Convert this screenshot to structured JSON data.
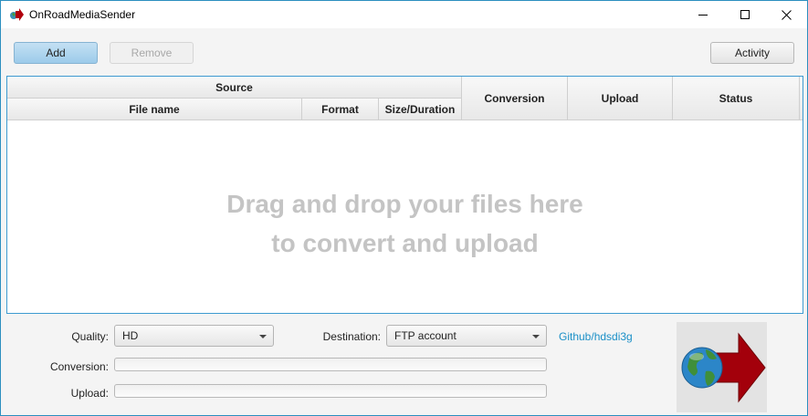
{
  "window": {
    "title": "OnRoadMediaSender",
    "controls": {
      "minimize": "minimize-icon",
      "maximize": "maximize-icon",
      "close": "close-icon"
    }
  },
  "toolbar": {
    "add_label": "Add",
    "remove_label": "Remove",
    "activity_label": "Activity"
  },
  "table": {
    "group_header": "Source",
    "columns": {
      "file_name": "File name",
      "format": "Format",
      "size_duration": "Size/Duration",
      "conversion": "Conversion",
      "upload": "Upload",
      "status": "Status"
    },
    "rows": [],
    "empty_line1": "Drag and drop your files here",
    "empty_line2": "to convert and upload"
  },
  "settings": {
    "quality_label": "Quality:",
    "quality_value": "HD",
    "destination_label": "Destination:",
    "destination_value": "FTP account",
    "github_link": "Github/hdsdi3g",
    "conversion_label": "Conversion:",
    "conversion_progress": 0,
    "upload_label": "Upload:",
    "upload_progress": 0
  },
  "colors": {
    "accent": "#3d9ad1",
    "primary_button": "#a9d2ee",
    "logo_arrow": "#a3000b",
    "placeholder_text": "#c4c4c4"
  },
  "logo": {
    "icon": "globe-arrow-icon"
  }
}
